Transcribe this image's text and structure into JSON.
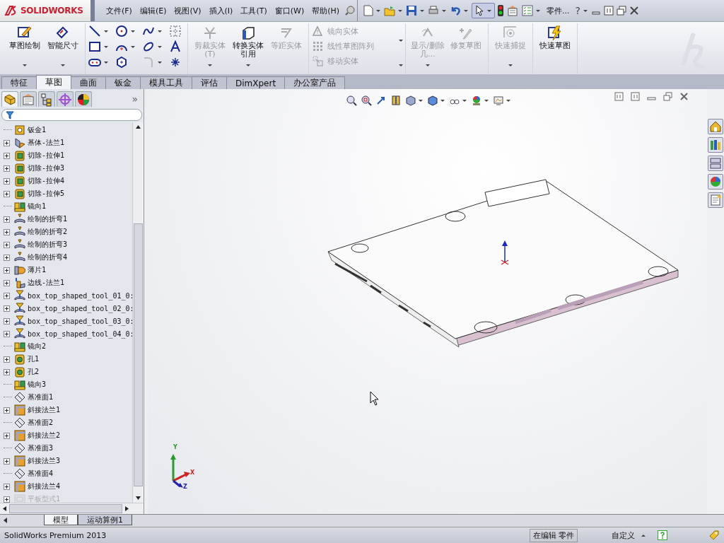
{
  "app": {
    "logo": "SOLIDWORKS",
    "menu": [
      "文件(F)",
      "编辑(E)",
      "视图(V)",
      "插入(I)",
      "工具(T)",
      "窗口(W)",
      "帮助(H)"
    ],
    "doc_title": "零件...",
    "help": "?"
  },
  "ribbon": [
    {
      "kind": "big",
      "items": [
        {
          "label": "草图绘制",
          "kind": "sketch",
          "disabled": false,
          "dropdown": true
        },
        {
          "label": "智能尺寸",
          "kind": "dimension",
          "disabled": false,
          "dropdown": true
        }
      ]
    },
    {
      "kind": "grid"
    },
    {
      "kind": "big",
      "items": [
        {
          "label": "剪裁实体(T)",
          "kind": "trim",
          "disabled": true,
          "dropdown": true
        },
        {
          "label": "转换实体引用",
          "kind": "convert",
          "disabled": false,
          "dropdown": true
        },
        {
          "label": "等距实体",
          "kind": "offset",
          "disabled": true,
          "dropdown": false
        }
      ]
    },
    {
      "kind": "list",
      "items": [
        {
          "label": "镜向实体",
          "kind": "mirror",
          "disabled": true
        },
        {
          "label": "线性草图阵列",
          "kind": "pattern",
          "disabled": true
        },
        {
          "label": "移动实体",
          "kind": "move",
          "disabled": true
        }
      ]
    },
    {
      "kind": "big",
      "items": [
        {
          "label": "显示/删除几...",
          "kind": "relations",
          "disabled": true,
          "dropdown": true
        },
        {
          "label": "修复草图",
          "kind": "repair",
          "disabled": true,
          "dropdown": false
        }
      ]
    },
    {
      "kind": "big",
      "items": [
        {
          "label": "快速捕捉",
          "kind": "snap",
          "disabled": true,
          "dropdown": true
        }
      ]
    },
    {
      "kind": "big",
      "items": [
        {
          "label": "快速草图",
          "kind": "rapid",
          "disabled": false,
          "dropdown": false
        }
      ]
    }
  ],
  "command_tabs": [
    {
      "label": "特征",
      "selected": false
    },
    {
      "label": "草图",
      "selected": true
    },
    {
      "label": "曲面",
      "selected": false
    },
    {
      "label": "钣金",
      "selected": false
    },
    {
      "label": "模具工具",
      "selected": false
    },
    {
      "label": "评估",
      "selected": false
    },
    {
      "label": "DimXpert",
      "selected": false
    },
    {
      "label": "办公室产品",
      "selected": false
    }
  ],
  "panel_tabs": [
    {
      "kind": "feature",
      "selected": true
    },
    {
      "kind": "property",
      "selected": false
    },
    {
      "kind": "config",
      "selected": false
    },
    {
      "kind": "dimxpert",
      "selected": false
    },
    {
      "kind": "display",
      "selected": false
    }
  ],
  "panel_more": "»",
  "tree": [
    {
      "label": "钣金1",
      "kind": "sheetmetal",
      "expandable": false,
      "disabled": false
    },
    {
      "label": "基体-法兰1",
      "kind": "baseflange",
      "expandable": true,
      "disabled": false
    },
    {
      "label": "切除-拉伸1",
      "kind": "cut",
      "expandable": true,
      "disabled": false
    },
    {
      "label": "切除-拉伸3",
      "kind": "cut",
      "expandable": true,
      "disabled": false
    },
    {
      "label": "切除-拉伸4",
      "kind": "cut",
      "expandable": true,
      "disabled": false
    },
    {
      "label": "切除-拉伸5",
      "kind": "cut",
      "expandable": true,
      "disabled": false
    },
    {
      "label": "镜向1",
      "kind": "mirror",
      "expandable": false,
      "disabled": false
    },
    {
      "label": "绘制的折弯1",
      "kind": "bend",
      "expandable": true,
      "disabled": false
    },
    {
      "label": "绘制的折弯2",
      "kind": "bend",
      "expandable": true,
      "disabled": false
    },
    {
      "label": "绘制的折弯3",
      "kind": "bend",
      "expandable": true,
      "disabled": false
    },
    {
      "label": "绘制的折弯4",
      "kind": "bend",
      "expandable": true,
      "disabled": false
    },
    {
      "label": "薄片1",
      "kind": "tab",
      "expandable": true,
      "disabled": false
    },
    {
      "label": "边线-法兰1",
      "kind": "edgeflange",
      "expandable": true,
      "disabled": false
    },
    {
      "label": "box_top_shaped_tool_01_0:",
      "kind": "formtool",
      "expandable": true,
      "disabled": false
    },
    {
      "label": "box_top_shaped_tool_02_0:",
      "kind": "formtool",
      "expandable": true,
      "disabled": false
    },
    {
      "label": "box_top_shaped_tool_03_0:",
      "kind": "formtool",
      "expandable": true,
      "disabled": false
    },
    {
      "label": "box_top_shaped_tool_04_0:",
      "kind": "formtool",
      "expandable": true,
      "disabled": false
    },
    {
      "label": "镜向2",
      "kind": "mirror",
      "expandable": false,
      "disabled": false
    },
    {
      "label": "孔1",
      "kind": "hole",
      "expandable": true,
      "disabled": false
    },
    {
      "label": "孔2",
      "kind": "hole",
      "expandable": true,
      "disabled": false
    },
    {
      "label": "镜向3",
      "kind": "mirror",
      "expandable": false,
      "disabled": false
    },
    {
      "label": "基准面1",
      "kind": "plane",
      "expandable": false,
      "disabled": false
    },
    {
      "label": "斜接法兰1",
      "kind": "miter",
      "expandable": true,
      "disabled": false
    },
    {
      "label": "基准面2",
      "kind": "plane",
      "expandable": false,
      "disabled": false
    },
    {
      "label": "斜接法兰2",
      "kind": "miter",
      "expandable": true,
      "disabled": false
    },
    {
      "label": "基准面3",
      "kind": "plane",
      "expandable": false,
      "disabled": false
    },
    {
      "label": "斜接法兰3",
      "kind": "miter",
      "expandable": true,
      "disabled": false
    },
    {
      "label": "基准面4",
      "kind": "plane",
      "expandable": false,
      "disabled": false
    },
    {
      "label": "斜接法兰4",
      "kind": "miter",
      "expandable": true,
      "disabled": false
    },
    {
      "label": "平板型式1",
      "kind": "flat",
      "expandable": true,
      "disabled": true
    }
  ],
  "triad": [
    "Y",
    "X",
    "Z"
  ],
  "bottom_tabs": [
    {
      "label": "模型",
      "selected": true
    },
    {
      "label": "运动算例1",
      "selected": false
    }
  ],
  "status_bar": {
    "product": "SolidWorks Premium 2013",
    "mode": "在编辑 零件",
    "units": "自定义"
  }
}
